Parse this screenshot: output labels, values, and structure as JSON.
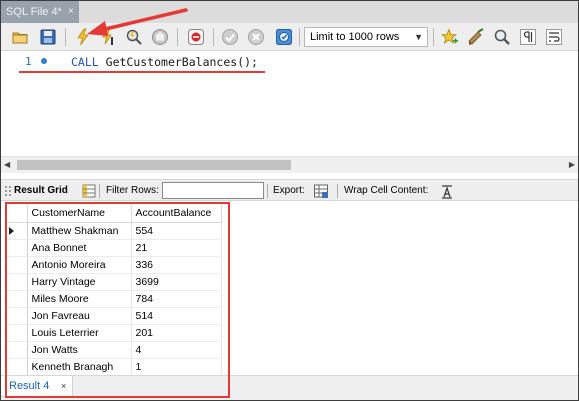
{
  "document_tab": {
    "title": "SQL File 4*",
    "close_glyph": "×"
  },
  "toolbar": {
    "icons": [
      "open-folder-icon",
      "save-icon",
      "execute-lightning-icon",
      "execute-cursor-lightning-icon",
      "explain-magnifier-icon",
      "stop-hand-icon",
      "toggle-error-icon",
      "commit-check-icon",
      "rollback-cancel-icon",
      "autocommit-icon",
      "add-snippet-star-icon",
      "beautify-broom-icon",
      "find-magnifier-icon",
      "invisible-chars-pilcrow-icon",
      "wrap-lines-icon"
    ],
    "limit_select": "Limit to 1000 rows"
  },
  "editor": {
    "line_number": "1",
    "keyword": "CALL",
    "statement": "GetCustomerBalances();"
  },
  "result_toolbar": {
    "result_grid_label": "Result Grid",
    "filter_rows_label": "Filter Rows:",
    "filter_rows_value": "",
    "export_label": "Export:",
    "wrap_cell_label": "Wrap Cell Content:"
  },
  "grid": {
    "columns": [
      "CustomerName",
      "AccountBalance"
    ],
    "rows": [
      [
        "Matthew Shakman",
        "554"
      ],
      [
        "Ana Bonnet",
        "21"
      ],
      [
        "Antonio Moreira",
        "336"
      ],
      [
        "Harry Vintage",
        "3699"
      ],
      [
        "Miles Moore",
        "784"
      ],
      [
        "Jon Favreau",
        "514"
      ],
      [
        "Louis Leterrier",
        "201"
      ],
      [
        "Jon Watts",
        "4"
      ],
      [
        "Kenneth Branagh",
        "1"
      ]
    ]
  },
  "result_tab": {
    "label": "Result 4",
    "close_glyph": "×"
  },
  "colors": {
    "annotation_red": "#e53935",
    "tab_blue": "#1565c0",
    "keyword_blue": "#2257b6"
  }
}
